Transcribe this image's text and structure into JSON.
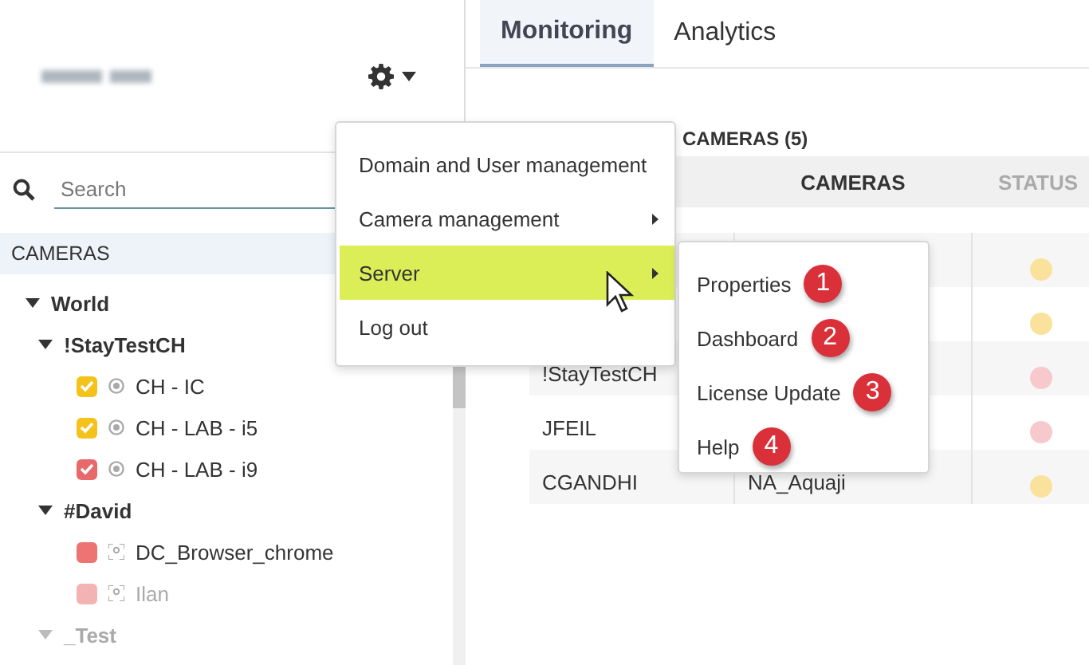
{
  "sidebar": {
    "search": {
      "placeholder": "Search"
    },
    "section_title": "CAMERAS",
    "tree": [
      {
        "kind": "group",
        "label": "World",
        "expanded": true,
        "disabled": false,
        "children": [
          {
            "kind": "group",
            "label": "!StayTestCH",
            "expanded": true,
            "disabled": false,
            "children": [
              {
                "label": "CH - IC",
                "kind": "ip",
                "checked": true,
                "color": "#f5c21b",
                "disabled": false
              },
              {
                "label": "CH - LAB - i5",
                "kind": "ip",
                "checked": true,
                "color": "#f5c21b",
                "disabled": false
              },
              {
                "label": "CH - LAB - i9",
                "kind": "ip",
                "checked": true,
                "color": "#e8696b",
                "disabled": false
              }
            ]
          },
          {
            "kind": "group",
            "label": "#David",
            "expanded": true,
            "disabled": false,
            "children": [
              {
                "label": "DC_Browser_chrome",
                "kind": "browser",
                "checked": false,
                "color": "#ee7474",
                "disabled": false
              },
              {
                "label": "Ilan",
                "kind": "browser",
                "checked": false,
                "color": "#f4b3b3",
                "disabled": true
              }
            ]
          },
          {
            "kind": "group",
            "label": "_Test",
            "expanded": true,
            "disabled": true
          }
        ]
      }
    ]
  },
  "tabs": [
    {
      "label": "Monitoring",
      "selected": true
    },
    {
      "label": "Analytics",
      "selected": false
    }
  ],
  "panel": {
    "title": "CAMERAS (5)",
    "columns": [
      "CAMERAS",
      "STATUS"
    ],
    "rows": [
      {
        "color": "#fbe29c"
      },
      {
        "color": "#fbe29c"
      },
      {
        "column_1": "!StayTestCH",
        "color": "#f7c9cd"
      },
      {
        "column_1": "JFEIL",
        "color": "#f7c9cd"
      },
      {
        "column_1": "CGANDHI",
        "column_2": "NA_Aquaji",
        "color": "#fbe29c"
      }
    ]
  },
  "menu": {
    "items": [
      {
        "label": "Domain and User management",
        "submenu": false,
        "selected": false
      },
      {
        "label": "Camera management",
        "submenu": true,
        "selected": false
      },
      {
        "label": "Server",
        "submenu": true,
        "selected": true
      },
      {
        "label": "Log out",
        "submenu": false,
        "selected": false
      }
    ]
  },
  "submenu": {
    "items": [
      {
        "label": "Properties",
        "badge": "1"
      },
      {
        "label": "Dashboard",
        "badge": "2"
      },
      {
        "label": "License Update",
        "badge": "3"
      },
      {
        "label": "Help",
        "badge": "4"
      }
    ]
  }
}
